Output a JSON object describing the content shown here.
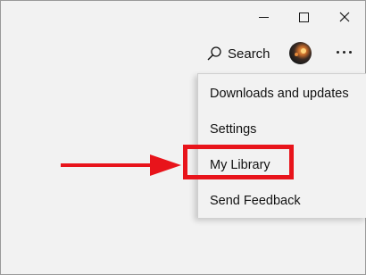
{
  "window": {
    "controls": {
      "minimize": "minimize-icon",
      "maximize": "maximize-icon",
      "close": "close-icon"
    }
  },
  "toolbar": {
    "search_label": "Search",
    "search_icon": "search-icon",
    "more_icon": "more-horizontal-icon"
  },
  "menu": {
    "items": [
      {
        "label": "Downloads and updates"
      },
      {
        "label": "Settings"
      },
      {
        "label": "My Library"
      },
      {
        "label": "Send Feedback"
      }
    ]
  },
  "annotation": {
    "highlight_color": "#e8141b",
    "arrow_color": "#e8141b",
    "highlighted_item": "My Library"
  },
  "colors": {
    "background": "#f2f2f2",
    "text": "#111111"
  }
}
